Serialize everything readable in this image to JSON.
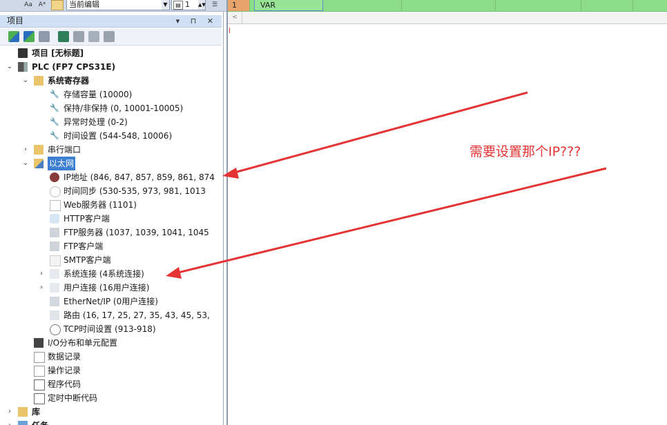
{
  "toolbar": {
    "icon_aa": "Aa",
    "icon_a_star": "A*",
    "combo_value": "当前编辑",
    "spin_value": "1"
  },
  "panel": {
    "title": "项目",
    "buttons": "▾ ⊓ ✕"
  },
  "tree": [
    {
      "label": "项目 [无标题]",
      "bold": true,
      "icon": "project-icon"
    },
    {
      "label": "PLC (FP7 CPS31E)",
      "bold": true,
      "icon": "plc-icon",
      "chevron": "expanded"
    },
    {
      "label": "系统寄存器",
      "bold": true,
      "icon": "folder-wrench-icon",
      "chevron": "expanded"
    },
    {
      "label": "存储容量 (10000)",
      "icon": "wrench-icon"
    },
    {
      "label": "保持/非保持 (0, 10001-10005)",
      "icon": "wrench-icon"
    },
    {
      "label": "异常时处理 (0-2)",
      "icon": "wrench-icon"
    },
    {
      "label": "时间设置 (544-548, 10006)",
      "icon": "wrench-icon"
    },
    {
      "label": "串行端口",
      "icon": "folder-wrench-icon",
      "chevron": "collapsed"
    },
    {
      "label": "以太网",
      "icon": "folder-globe-icon",
      "chevron": "expanded",
      "selected": true
    },
    {
      "label": "IP地址 (846, 847, 857, 859, 861, 874",
      "icon": "ip-icon"
    },
    {
      "label": "时间同步 (530-535, 973, 981, 1013",
      "icon": "clock-icon"
    },
    {
      "label": "Web服务器 (1101)",
      "icon": "device-icon"
    },
    {
      "label": "HTTP客户端",
      "icon": "cylinder-icon"
    },
    {
      "label": "FTP服务器 (1037, 1039, 1041, 1045",
      "icon": "server-icon"
    },
    {
      "label": "FTP客户端",
      "icon": "server-icon"
    },
    {
      "label": "SMTP客户端",
      "icon": "envelope-icon"
    },
    {
      "label": "系统连接 (4系统连接)",
      "icon": "connection-icon",
      "chevron": "collapsed"
    },
    {
      "label": "用户连接 (16用户连接)",
      "icon": "connection-icon",
      "chevron": "collapsed"
    },
    {
      "label": "EtherNet/IP (0用户连接)",
      "icon": "network-icon"
    },
    {
      "label": "路由 (16, 17, 25, 27, 35, 43, 45, 53,",
      "icon": "route-icon"
    },
    {
      "label": "TCP时间设置 (913-918)",
      "icon": "stopwatch-icon"
    },
    {
      "label": "I/O分布和单元配置",
      "icon": "io-icon"
    },
    {
      "label": "数据记录",
      "icon": "record-icon"
    },
    {
      "label": "操作记录",
      "icon": "record-icon"
    },
    {
      "label": "程序代码",
      "icon": "code-icon"
    },
    {
      "label": "定时中断代码",
      "icon": "code-icon"
    },
    {
      "label": "库",
      "bold": true,
      "icon": "library-icon",
      "chevron": "collapsed"
    },
    {
      "label": "任务",
      "bold": true,
      "icon": "task-icon",
      "chevron": "collapsed"
    }
  ],
  "editor": {
    "row_number": "1",
    "row_var": "VAR"
  },
  "annotation": {
    "text": "需要设置那个IP???",
    "color": "#e53333"
  }
}
